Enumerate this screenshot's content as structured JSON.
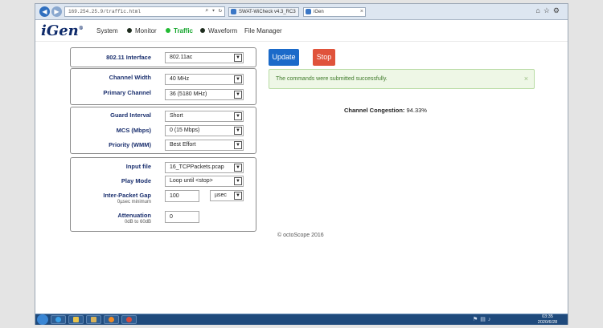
{
  "browser": {
    "address": "169.254.25.9/traffic.html",
    "tabs": [
      {
        "label": "SWAT-WiCheck v4.3_RC3"
      },
      {
        "label": "iGen"
      }
    ]
  },
  "app": {
    "logo": "iGen",
    "logo_mark": "®",
    "nav": [
      {
        "label": "System",
        "dot": false
      },
      {
        "label": "Monitor",
        "dot": true,
        "dot_color": "#1f2d1f"
      },
      {
        "label": "Traffic",
        "dot": true,
        "dot_color": "#22bb33",
        "active": true
      },
      {
        "label": "Waveform",
        "dot": true,
        "dot_color": "#1f2d1f"
      },
      {
        "label": "File Manager",
        "dot": false
      }
    ]
  },
  "form": {
    "interface": {
      "label": "802.11 Interface",
      "value": "802.11ac"
    },
    "channel_width": {
      "label": "Channel Width",
      "value": "40 MHz"
    },
    "primary_channel": {
      "label": "Primary Channel",
      "value": "36 (5180 MHz)"
    },
    "guard_interval": {
      "label": "Guard Interval",
      "value": "Short"
    },
    "mcs": {
      "label": "MCS (Mbps)",
      "value": "0 (15 Mbps)"
    },
    "priority": {
      "label": "Priority (WMM)",
      "value": "Best Effort"
    },
    "input_file": {
      "label": "Input file",
      "value": "16_TCPPackets.pcap"
    },
    "play_mode": {
      "label": "Play Mode",
      "value": "Loop until <stop>"
    },
    "inter_packet_gap": {
      "label": "Inter-Packet Gap",
      "sublabel": "0µsec minimum",
      "value": "100",
      "unit": "µsec"
    },
    "attenuation": {
      "label": "Attenuation",
      "sublabel": "0dB to 60dB",
      "value": "0"
    }
  },
  "actions": {
    "update_label": "Update",
    "stop_label": "Stop"
  },
  "alert": {
    "message": "The commands were submitted successfully.",
    "close_glyph": "×"
  },
  "status": {
    "congestion_label": "Channel Congestion:",
    "congestion_value": "94.33%"
  },
  "footer": {
    "copyright": "© octoScope 2016"
  },
  "taskbar": {
    "time": "03:35",
    "date": "2020/6/28"
  },
  "colors": {
    "brand_navy": "#0f2b6b",
    "active_green": "#14a52c",
    "update_blue": "#1b6ac9",
    "stop_red": "#e0533b",
    "label_navy": "#1a2f6e"
  }
}
